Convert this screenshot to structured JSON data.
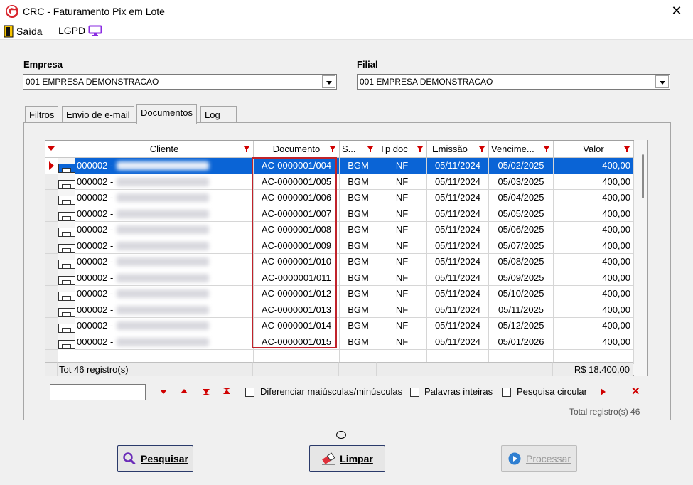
{
  "window": {
    "title": "CRC - Faturamento Pix em Lote",
    "close": "✕"
  },
  "menu": {
    "saida": "Saída",
    "lgpd": "LGPD"
  },
  "empresa": {
    "label": "Empresa",
    "value": "001 EMPRESA DEMONSTRACAO"
  },
  "filial": {
    "label": "Filial",
    "value": "001 EMPRESA DEMONSTRACAO"
  },
  "tabs": [
    "Filtros",
    "Envio de e-mail",
    "Documentos",
    "Log"
  ],
  "grid": {
    "columns": [
      "Cliente",
      "Documento",
      "S...",
      "Tp doc",
      "Emissão",
      "Vencime...",
      "Valor"
    ],
    "rows": [
      {
        "cliente": "000002 -",
        "documento": "AC-0000001/004",
        "s": "BGM",
        "tp": "NF",
        "emissao": "05/11/2024",
        "venc": "05/02/2025",
        "valor": "400,00"
      },
      {
        "cliente": "000002 -",
        "documento": "AC-0000001/005",
        "s": "BGM",
        "tp": "NF",
        "emissao": "05/11/2024",
        "venc": "05/03/2025",
        "valor": "400,00"
      },
      {
        "cliente": "000002 -",
        "documento": "AC-0000001/006",
        "s": "BGM",
        "tp": "NF",
        "emissao": "05/11/2024",
        "venc": "05/04/2025",
        "valor": "400,00"
      },
      {
        "cliente": "000002 -",
        "documento": "AC-0000001/007",
        "s": "BGM",
        "tp": "NF",
        "emissao": "05/11/2024",
        "venc": "05/05/2025",
        "valor": "400,00"
      },
      {
        "cliente": "000002 -",
        "documento": "AC-0000001/008",
        "s": "BGM",
        "tp": "NF",
        "emissao": "05/11/2024",
        "venc": "05/06/2025",
        "valor": "400,00"
      },
      {
        "cliente": "000002 -",
        "documento": "AC-0000001/009",
        "s": "BGM",
        "tp": "NF",
        "emissao": "05/11/2024",
        "venc": "05/07/2025",
        "valor": "400,00"
      },
      {
        "cliente": "000002 -",
        "documento": "AC-0000001/010",
        "s": "BGM",
        "tp": "NF",
        "emissao": "05/11/2024",
        "venc": "05/08/2025",
        "valor": "400,00"
      },
      {
        "cliente": "000002 -",
        "documento": "AC-0000001/011",
        "s": "BGM",
        "tp": "NF",
        "emissao": "05/11/2024",
        "venc": "05/09/2025",
        "valor": "400,00"
      },
      {
        "cliente": "000002 -",
        "documento": "AC-0000001/012",
        "s": "BGM",
        "tp": "NF",
        "emissao": "05/11/2024",
        "venc": "05/10/2025",
        "valor": "400,00"
      },
      {
        "cliente": "000002 -",
        "documento": "AC-0000001/013",
        "s": "BGM",
        "tp": "NF",
        "emissao": "05/11/2024",
        "venc": "05/11/2025",
        "valor": "400,00"
      },
      {
        "cliente": "000002 -",
        "documento": "AC-0000001/014",
        "s": "BGM",
        "tp": "NF",
        "emissao": "05/11/2024",
        "venc": "05/12/2025",
        "valor": "400,00"
      },
      {
        "cliente": "000002 -",
        "documento": "AC-0000001/015",
        "s": "BGM",
        "tp": "NF",
        "emissao": "05/11/2024",
        "venc": "05/01/2026",
        "valor": "400,00"
      }
    ],
    "footer": {
      "tot": "Tot",
      "count": "46 registro(s)",
      "sum": "R$ 18.400,00"
    }
  },
  "search": {
    "diferenciar": "Diferenciar maiúsculas/minúsculas",
    "palavras": "Palavras inteiras",
    "circular": "Pesquisa circular",
    "total": "Total registro(s) 46"
  },
  "buttons": {
    "pesquisar": "Pesquisar",
    "limpar": "Limpar",
    "processar": "Processar"
  },
  "colors": {
    "selection": "#0a64d6",
    "highlight": "#c0232b",
    "filter": "#d00000"
  }
}
